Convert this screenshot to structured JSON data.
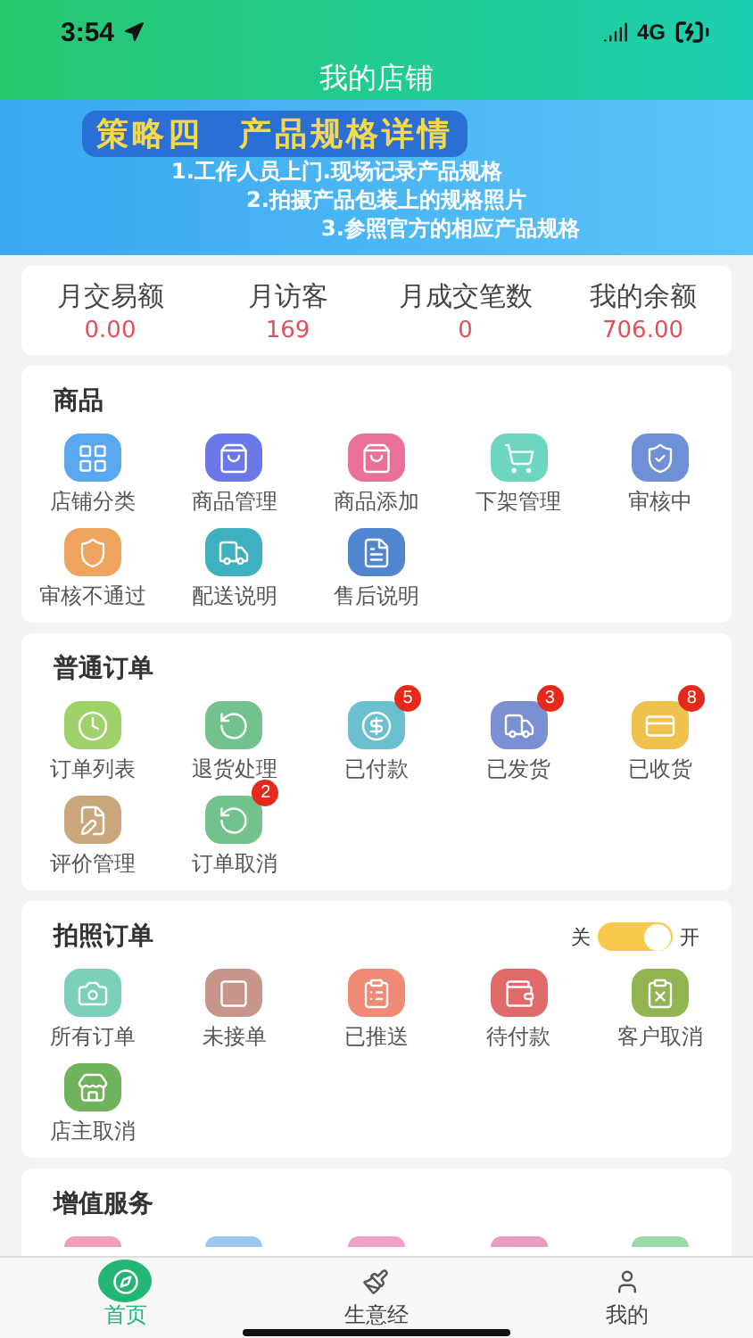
{
  "status_bar": {
    "time": "3:54",
    "network": "4G"
  },
  "header": {
    "title": "我的店铺"
  },
  "banner": {
    "title": "策略四　产品规格详情",
    "lines": [
      "1.工作人员上门.现场记录产品规格",
      "2.拍摄产品包装上的规格照片",
      "3.参照官方的相应产品规格"
    ]
  },
  "stats": [
    {
      "label": "月交易额",
      "value": "0.00"
    },
    {
      "label": "月访客",
      "value": "169"
    },
    {
      "label": "月成交笔数",
      "value": "0"
    },
    {
      "label": "我的余额",
      "value": "706.00"
    }
  ],
  "sections": [
    {
      "title": "商品",
      "items": [
        {
          "label": "店铺分类",
          "color": "#5aa9f0"
        },
        {
          "label": "商品管理",
          "color": "#6d78e8"
        },
        {
          "label": "商品添加",
          "color": "#e8709a"
        },
        {
          "label": "下架管理",
          "color": "#6ed6c0"
        },
        {
          "label": "审核中",
          "color": "#6f8fd6"
        },
        {
          "label": "审核不通过",
          "color": "#eea45e"
        },
        {
          "label": "配送说明",
          "color": "#3fb0c0"
        },
        {
          "label": "售后说明",
          "color": "#4f86cf"
        }
      ]
    },
    {
      "title": "普通订单",
      "items": [
        {
          "label": "订单列表",
          "color": "#9fd36a"
        },
        {
          "label": "退货处理",
          "color": "#72c28e"
        },
        {
          "label": "已付款",
          "color": "#6bc0cf",
          "badge": "5"
        },
        {
          "label": "已发货",
          "color": "#7b8fd3",
          "badge": "3"
        },
        {
          "label": "已收货",
          "color": "#efc24e",
          "badge": "8"
        },
        {
          "label": "评价管理",
          "color": "#c9a77a"
        },
        {
          "label": "订单取消",
          "color": "#72c28e",
          "badge": "2"
        }
      ]
    },
    {
      "title": "拍照订单",
      "toggle": {
        "off_label": "关",
        "on_label": "开",
        "on": true
      },
      "items": [
        {
          "label": "所有订单",
          "color": "#7ccfb8"
        },
        {
          "label": "未接单",
          "color": "#c7958a"
        },
        {
          "label": "已推送",
          "color": "#ee8a76"
        },
        {
          "label": "待付款",
          "color": "#e06a6a"
        },
        {
          "label": "客户取消",
          "color": "#92b552"
        },
        {
          "label": "店主取消",
          "color": "#6fb35c"
        }
      ]
    }
  ],
  "value_added": {
    "title": "增值服务",
    "items": [
      {
        "color": "#f0a0b8"
      },
      {
        "color": "#9cc8f0"
      },
      {
        "color": "#f0a0c8"
      },
      {
        "color": "#e89cc0"
      },
      {
        "color": "#9cd8a8"
      }
    ]
  },
  "tab_bar": [
    {
      "label": "首页",
      "selected": true
    },
    {
      "label": "生意经",
      "selected": false
    },
    {
      "label": "我的",
      "selected": false
    }
  ]
}
